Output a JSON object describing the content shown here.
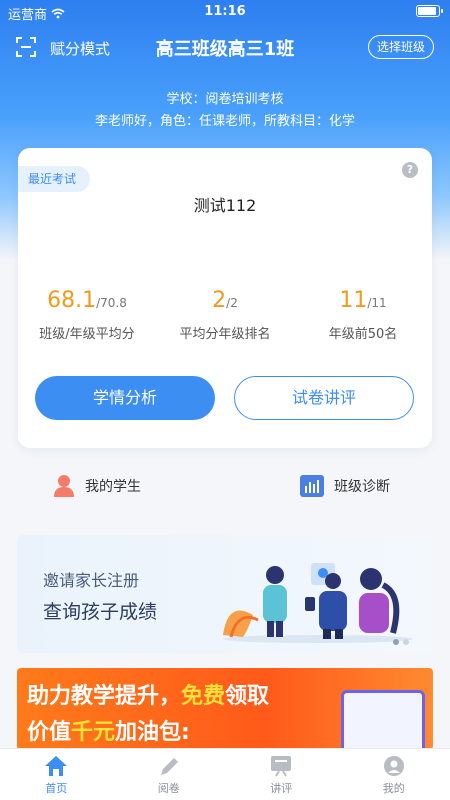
{
  "status": {
    "carrier": "运营商",
    "time": "11:16"
  },
  "nav": {
    "mode_label": "赋分模式",
    "class_title": "高三班级高三1班",
    "choose_class": "选择班级"
  },
  "info": {
    "school": "学校：阅卷培训考核",
    "teacher": "李老师好，角色：任课老师，所教科目：化学"
  },
  "card": {
    "tag": "最近考试",
    "exam_name": "测试112",
    "stats": [
      {
        "value": "68.1",
        "total": "/70.8",
        "label": "班级/年级平均分"
      },
      {
        "value": "2",
        "total": "/2",
        "label": "平均分年级排名"
      },
      {
        "value": "11",
        "total": "/11",
        "label": "年级前50名"
      }
    ],
    "primary_button": "学情分析",
    "secondary_button": "试卷讲评"
  },
  "quick": {
    "students": "我的学生",
    "diagnosis": "班级诊断"
  },
  "banner_invite": {
    "line1": "邀请家长注册",
    "line2": "查询孩子成绩"
  },
  "banner_promo": {
    "line1_a": "助力教学提升，",
    "line1_b": "免费",
    "line1_c": "领取",
    "line2_a": "价值",
    "line2_b": "千元",
    "line2_c": "加油包:"
  },
  "tabs": [
    {
      "label": "首页",
      "icon": "home-icon",
      "active": true
    },
    {
      "label": "阅卷",
      "icon": "pen-icon",
      "active": false
    },
    {
      "label": "讲评",
      "icon": "board-icon",
      "active": false
    },
    {
      "label": "我的",
      "icon": "user-icon",
      "active": false
    }
  ],
  "colors": {
    "accent": "#3d8ef2",
    "stat": "#f29b1b",
    "promo": "#ff5a1a"
  }
}
